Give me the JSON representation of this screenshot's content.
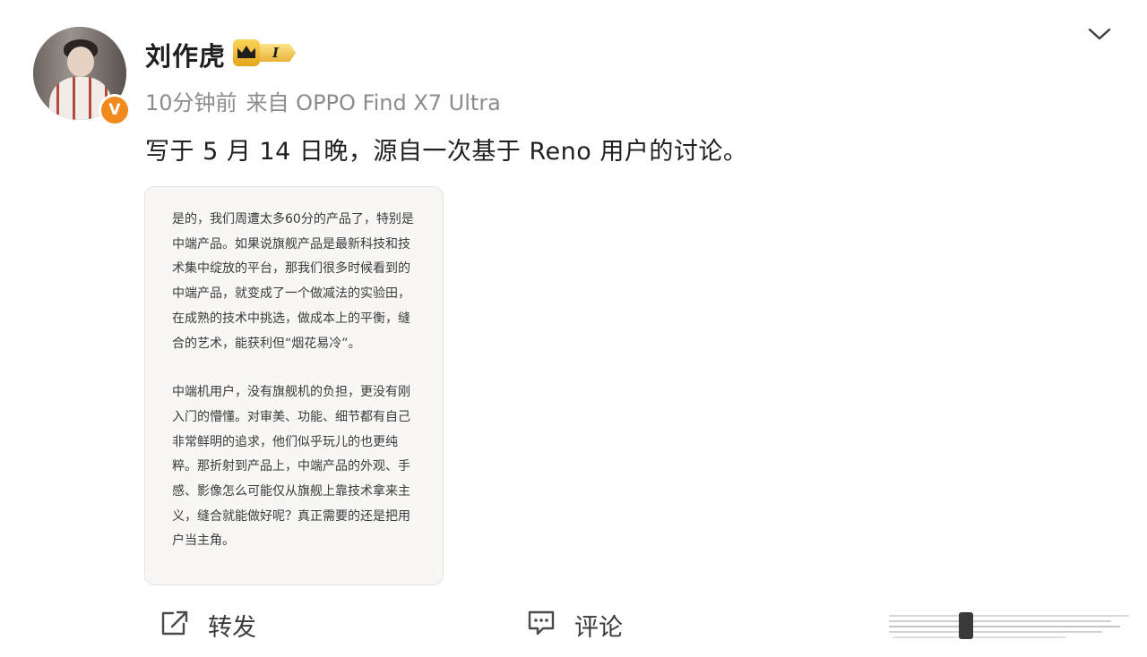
{
  "post": {
    "username": "刘作虎",
    "vip_level": "I",
    "time": "10分钟前",
    "source": "来自 OPPO Find X7 Ultra",
    "verified_badge": "V",
    "text": "写于 5 月 14 日晚，源自一次基于 Reno 用户的讨论。",
    "image_text": {
      "para1": "是的，我们周遭太多60分的产品了，特别是中端产品。如果说旗舰产品是最新科技和技术集中绽放的平台，那我们很多时候看到的中端产品，就变成了一个做减法的实验田，在成熟的技术中挑选，做成本上的平衡，缝合的艺术，能获利但“烟花易冷”。",
      "para2": "中端机用户，没有旗舰机的负担，更没有刚入门的懵懂。对审美、功能、细节都有自己非常鲜明的追求，他们似乎玩儿的也更纯粹。那折射到产品上，中端产品的外观、手感、影像怎么可能仅从旗舰上靠技术拿来主义，缝合就能做好呢？真正需要的还是把用户当主角。"
    }
  },
  "actions": {
    "repost_label": "转发",
    "comment_label": "评论"
  },
  "icons": {
    "more": "chevron-down-icon",
    "repost": "share-icon",
    "comment": "comment-icon",
    "like": "like-icon"
  },
  "colors": {
    "verified": "#f08a1c",
    "meta_text": "#8c8c8c",
    "vip_gold": "#e4a51a"
  }
}
